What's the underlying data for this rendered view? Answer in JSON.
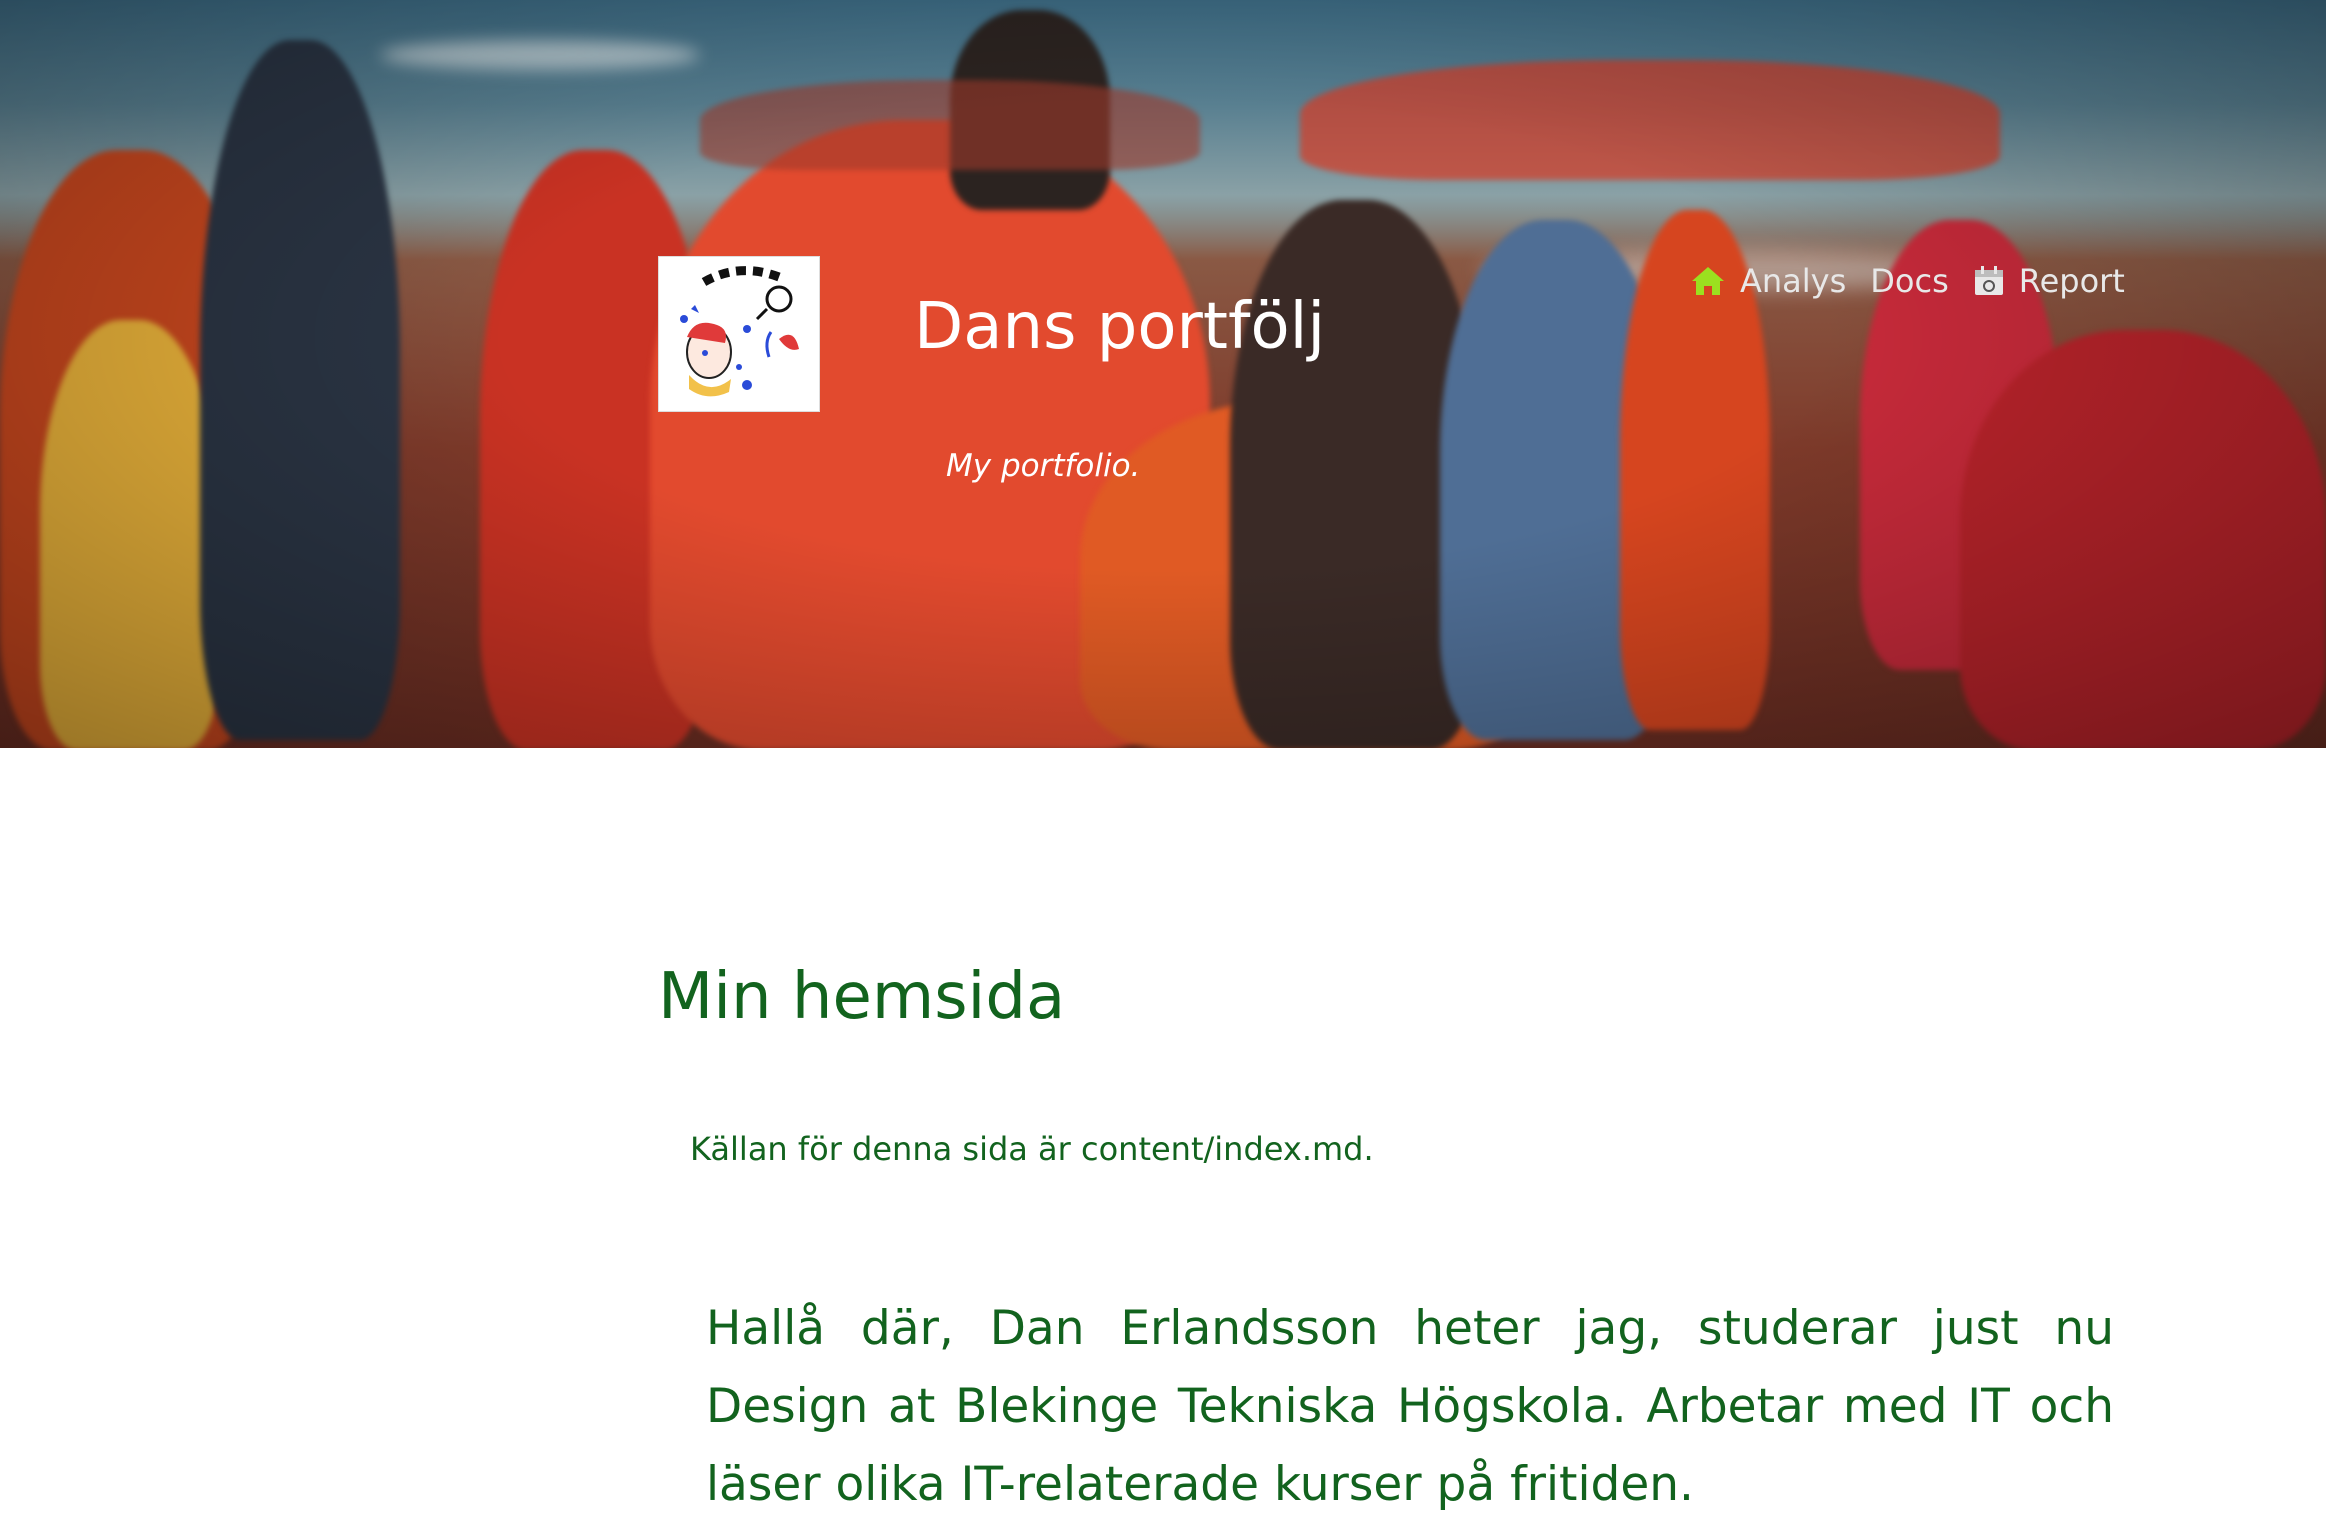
{
  "header": {
    "site_title": "Dans portfölj",
    "site_slogan": "My portfolio.",
    "logo_alt": "logo"
  },
  "nav": {
    "items": [
      {
        "label": "Analys",
        "icon": "home-icon"
      },
      {
        "label": "Docs",
        "icon": ""
      },
      {
        "label": "Report",
        "icon": "calendar-icon"
      }
    ]
  },
  "main": {
    "title": "Min hemsida",
    "source_note": "Källan för denna sida är content/index.md.",
    "intro": "Hallå där, Dan Erlandsson heter jag, studerar just nu Design at Blekinge Tekniska Högskola. Arbetar med IT och läser olika IT-relaterade kurser på fritiden."
  },
  "colors": {
    "heading_green": "#12631e",
    "nav_home_icon": "#9be01f",
    "header_text": "#ffffff"
  }
}
